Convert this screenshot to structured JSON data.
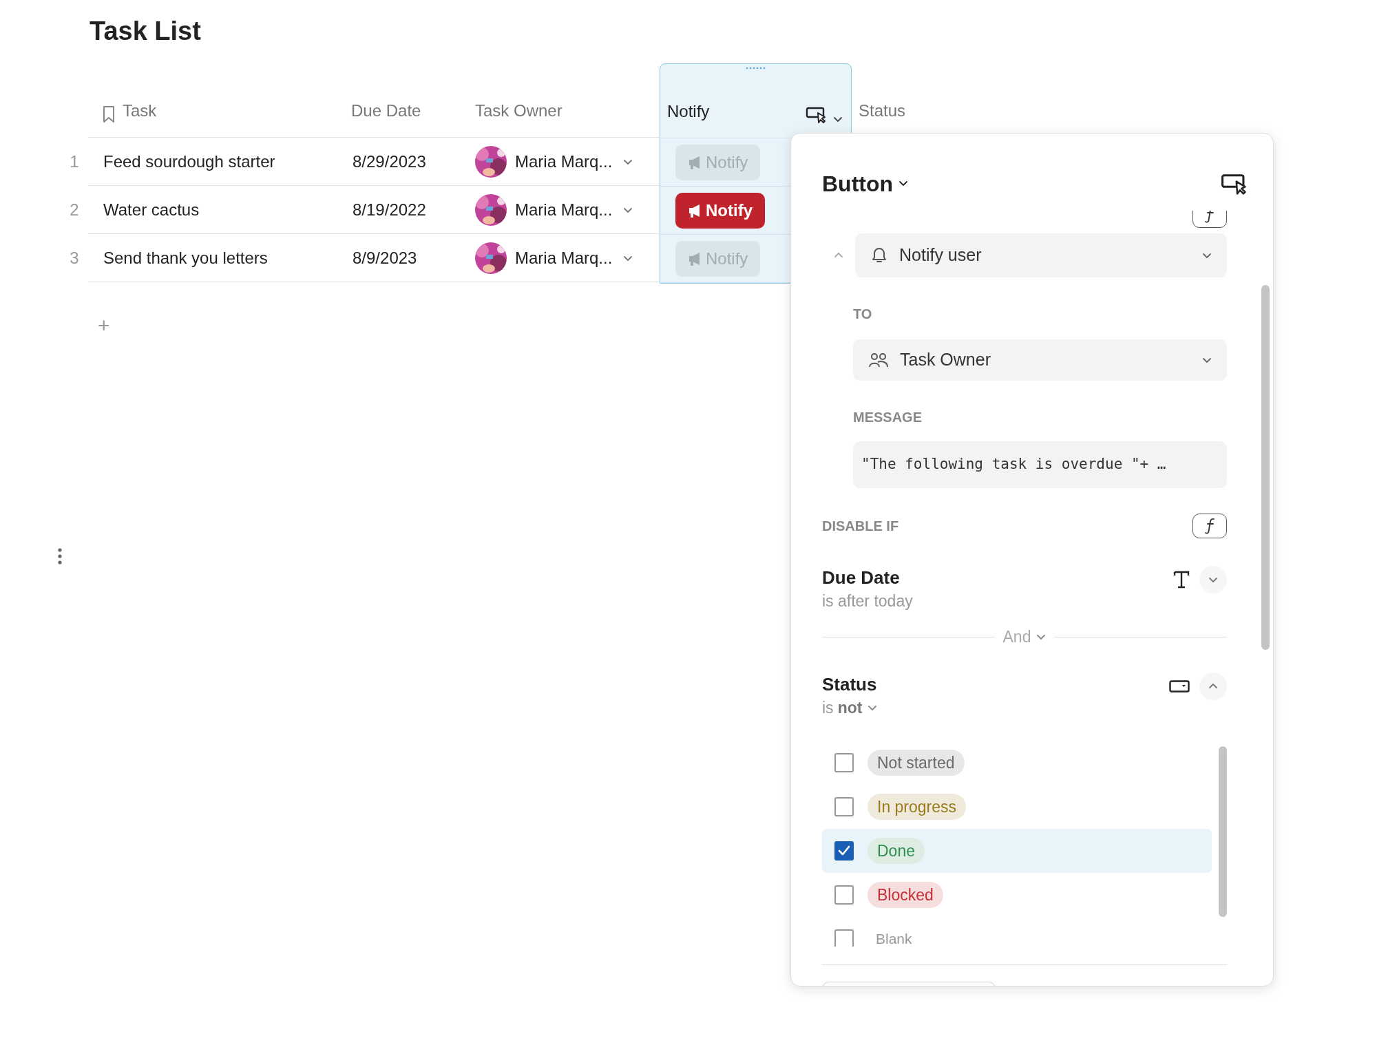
{
  "title": "Task List",
  "table": {
    "columns": [
      {
        "label": "Task",
        "selected": false
      },
      {
        "label": "Due Date",
        "selected": false
      },
      {
        "label": "Task Owner",
        "selected": false
      },
      {
        "label": "Notify",
        "selected": true
      },
      {
        "label": "Status",
        "selected": false
      }
    ],
    "rows": [
      {
        "number": "1",
        "task": "Feed sourdough starter",
        "due_date": "8/29/2023",
        "owner": "Maria Marq...",
        "button": {
          "label": "Notify",
          "disabled": true
        }
      },
      {
        "number": "2",
        "task": "Water cactus",
        "due_date": "8/19/2022",
        "owner": "Maria Marq...",
        "button": {
          "label": "Notify",
          "disabled": false
        }
      },
      {
        "number": "3",
        "task": "Send thank you letters",
        "due_date": "8/9/2023",
        "owner": "Maria Marq...",
        "button": {
          "label": "Notify",
          "disabled": true
        }
      }
    ],
    "add_row": "+"
  },
  "panel": {
    "title": "Button",
    "action": {
      "value": "Notify user"
    },
    "to": {
      "label": "TO",
      "value": "Task Owner"
    },
    "message": {
      "label": "MESSAGE",
      "value": "\"The following task is overdue \"+ …"
    },
    "disable_if": {
      "label": "DISABLE IF",
      "joiner": "And",
      "conditions": [
        {
          "kind": "text",
          "field": "Due Date",
          "rule": "is after today",
          "expanded": false
        },
        {
          "kind": "select",
          "field": "Status",
          "rule": "is **not**",
          "expanded": true,
          "options": [
            {
              "label": "Not started",
              "checked": false,
              "color": "#6b6b6b"
            },
            {
              "label": "In progress",
              "checked": false,
              "color": "#9a7b1c"
            },
            {
              "label": "Done",
              "checked": true,
              "color": "#2f8f4e"
            },
            {
              "label": "Blocked",
              "checked": false,
              "color": "#c62f35"
            },
            {
              "label": "Blank",
              "checked": false
            }
          ]
        }
      ]
    }
  }
}
